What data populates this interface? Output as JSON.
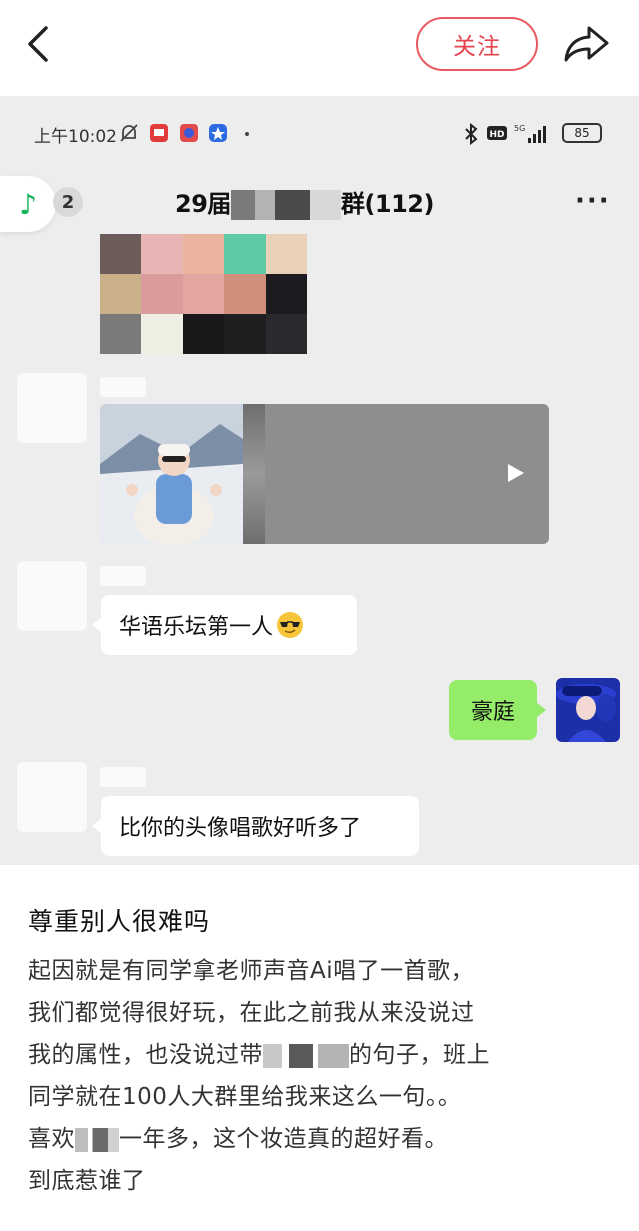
{
  "topbar": {
    "follow_label": "关注"
  },
  "screenshot": {
    "status_bar": {
      "time": "上午10:02",
      "battery": "85",
      "network": "5G"
    },
    "chat": {
      "unread_count": "2",
      "title": "29届 群(112)",
      "title_prefix": "29届",
      "title_suffix": "群(112)",
      "more": "···"
    },
    "messages": {
      "msg1": "华语乐坛第一人",
      "my_msg": "豪庭",
      "msg2": "比你的头像唱歌好听多了"
    }
  },
  "post": {
    "title": "尊重别人很难吗",
    "lines": [
      "起因就是有同学拿老师声音Ai唱了一首歌，",
      "我们都觉得很好玩，在此之前我从来没说过",
      "我的属性，也没说过带",
      "的句子，班上",
      "同学就在100人大群里给我来这么一句。。",
      "喜欢",
      "一年多，这个妆造真的超好看。",
      "到底惹谁了"
    ]
  },
  "colors": {
    "follow_red": "#e3444e",
    "chat_bg": "#ededed",
    "my_bubble": "#95ec69",
    "music_green": "#14b45a"
  }
}
